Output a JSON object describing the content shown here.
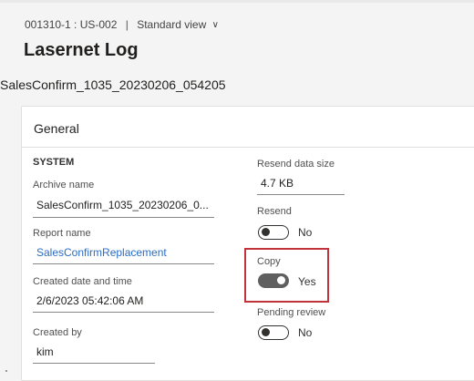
{
  "header": {
    "record_id": "001310-1 : US-002",
    "separator": "|",
    "view_name": "Standard view"
  },
  "page": {
    "title": "Lasernet Log",
    "record_name": "SalesConfirm_1035_20230206_054205"
  },
  "general": {
    "title": "General",
    "group_system": "SYSTEM",
    "archive_name": {
      "label": "Archive name",
      "value": "SalesConfirm_1035_20230206_0..."
    },
    "report_name": {
      "label": "Report name",
      "value": "SalesConfirmReplacement"
    },
    "created_datetime": {
      "label": "Created date and time",
      "value": "2/6/2023 05:42:06 AM"
    },
    "created_by": {
      "label": "Created by",
      "value": "kim"
    },
    "resend_data_size": {
      "label": "Resend data size",
      "value": "4.7 KB"
    },
    "resend": {
      "label": "Resend",
      "state": "No",
      "on": false
    },
    "copy": {
      "label": "Copy",
      "state": "Yes",
      "on": true
    },
    "pending_review": {
      "label": "Pending review",
      "state": "No",
      "on": false
    }
  },
  "colors": {
    "link": "#2b6cc0",
    "highlight": "#c0333a",
    "toggle_on": "#5f5f5f"
  }
}
